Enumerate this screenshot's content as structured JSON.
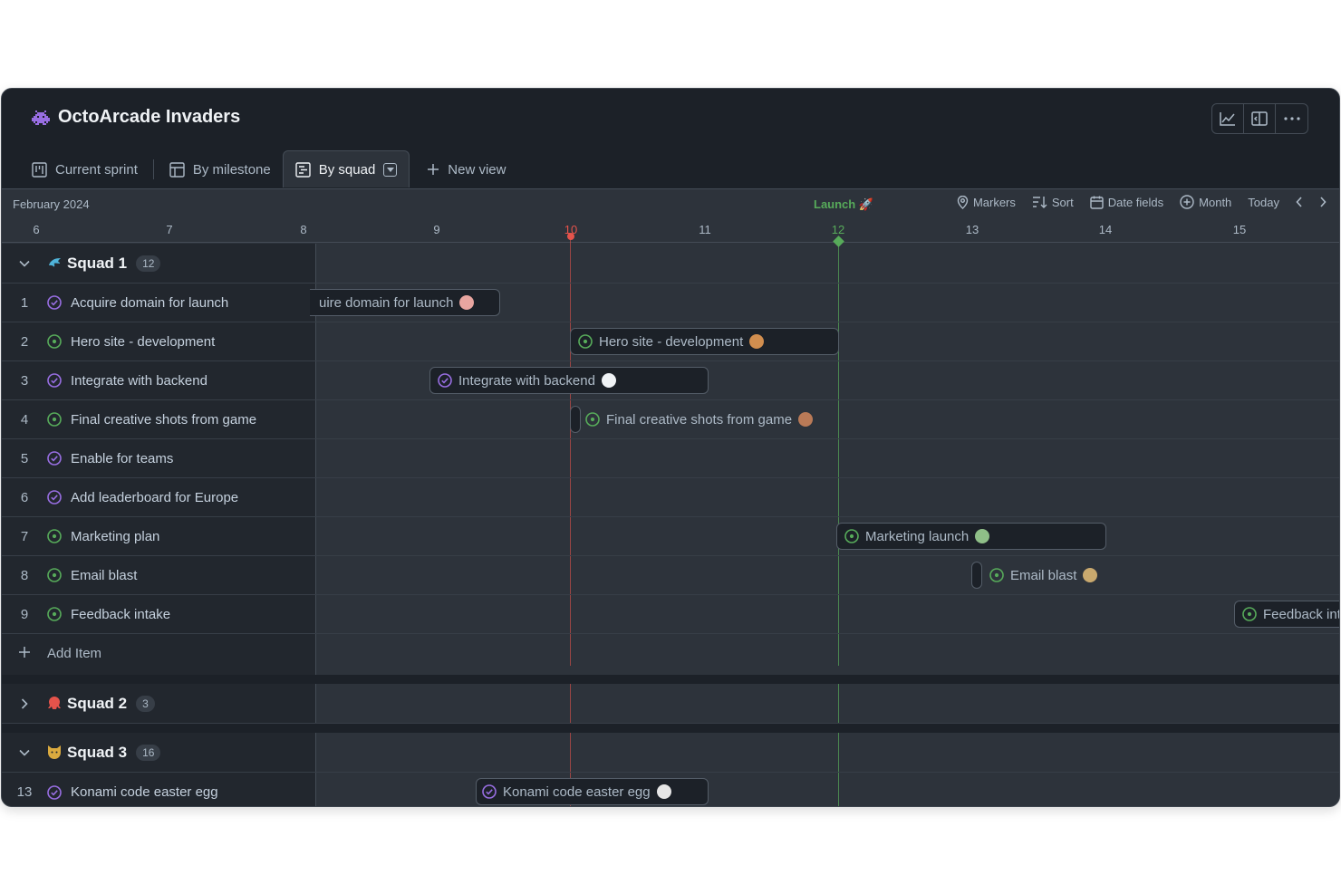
{
  "project": {
    "title": "OctoArcade Invaders",
    "logo_icon": "space-invader-icon"
  },
  "header_actions": [
    "chart-icon",
    "sidebar-panel-icon",
    "more-icon"
  ],
  "tabs": [
    {
      "label": "Current sprint",
      "icon": "board-icon"
    },
    {
      "label": "By milestone",
      "icon": "table-icon"
    },
    {
      "label": "By squad",
      "icon": "roadmap-icon",
      "active": true
    },
    {
      "label": "New view",
      "icon": "plus-icon"
    }
  ],
  "toolbar": {
    "month": "February 2024",
    "launch_marker": "Launch 🚀",
    "markers": "Markers",
    "sort": "Sort",
    "date_fields": "Date fields",
    "zoom": "Month",
    "today": "Today"
  },
  "days": [
    "6",
    "7",
    "8",
    "9",
    "10",
    "11",
    "12",
    "13",
    "14",
    "15"
  ],
  "colors": {
    "today": "#e5534b",
    "launch": "#57ab5a",
    "open": "#57ab5a",
    "done": "#986ee2"
  },
  "groups": [
    {
      "name": "Squad 1",
      "emoji": "🐬",
      "count": "12",
      "expanded": true,
      "items": [
        {
          "num": "1",
          "title": "Acquire domain for launch",
          "status": "done",
          "bar_label": "uire domain for launch"
        },
        {
          "num": "2",
          "title": "Hero site - development",
          "status": "open",
          "bar_label": "Hero site - development"
        },
        {
          "num": "3",
          "title": "Integrate with backend",
          "status": "done",
          "bar_label": "Integrate with backend"
        },
        {
          "num": "4",
          "title": "Final creative shots from game",
          "status": "open",
          "bar_label": "Final creative shots from game"
        },
        {
          "num": "5",
          "title": "Enable for teams",
          "status": "done"
        },
        {
          "num": "6",
          "title": "Add leaderboard for Europe",
          "status": "done"
        },
        {
          "num": "7",
          "title": "Marketing plan",
          "status": "open",
          "bar_label": "Marketing launch"
        },
        {
          "num": "8",
          "title": "Email blast",
          "status": "open",
          "bar_label": "Email blast"
        },
        {
          "num": "9",
          "title": "Feedback intake",
          "status": "open",
          "bar_label": "Feedback int"
        }
      ],
      "add_item": "Add Item"
    },
    {
      "name": "Squad 2",
      "emoji": "🐙",
      "count": "3",
      "expanded": false
    },
    {
      "name": "Squad 3",
      "emoji": "🐱",
      "count": "16",
      "expanded": true,
      "items": [
        {
          "num": "13",
          "title": "Konami code easter egg",
          "status": "done",
          "bar_label": "Konami code easter egg"
        }
      ]
    }
  ]
}
